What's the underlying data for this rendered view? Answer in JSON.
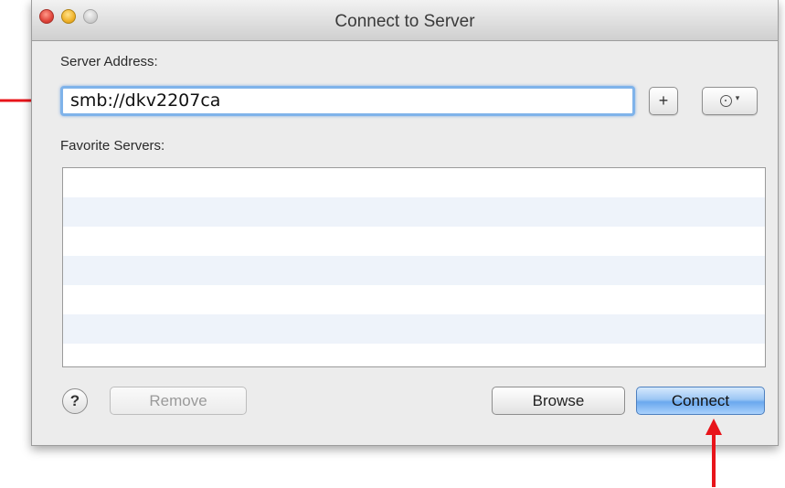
{
  "window": {
    "title": "Connect to Server",
    "controls": [
      "close",
      "minimize",
      "zoom"
    ]
  },
  "server_address": {
    "label": "Server Address:",
    "value": "smb://dkv2207ca",
    "add_label": "+",
    "recent_icon": "clock-icon",
    "recent_caret": "▾"
  },
  "favorites": {
    "label": "Favorite Servers:",
    "items": []
  },
  "footer": {
    "help_label": "?",
    "remove_label": "Remove",
    "browse_label": "Browse",
    "connect_label": "Connect"
  },
  "annotations": {
    "arrow_color": "#e8141a",
    "arrows": [
      "arrow-to-server-address",
      "arrow-to-connect-button"
    ]
  },
  "colors": {
    "accent": "#7fb3ea",
    "connect_button": "#6aa8ee"
  }
}
